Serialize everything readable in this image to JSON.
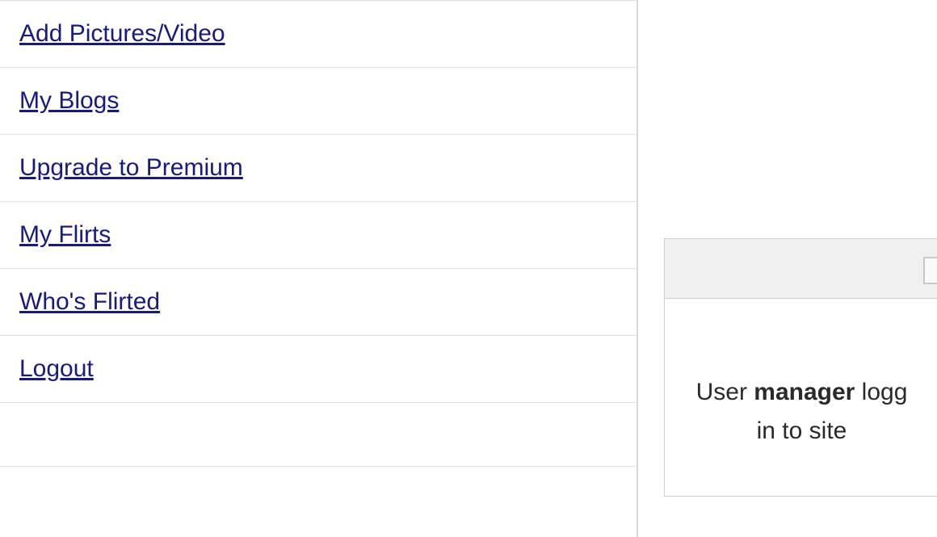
{
  "sidebar": {
    "items": [
      {
        "label": "Add Pictures/Video"
      },
      {
        "label": "My Blogs"
      },
      {
        "label": "Upgrade to Premium"
      },
      {
        "label": "My Flirts"
      },
      {
        "label": "Who's Flirted"
      },
      {
        "label": "Logout"
      }
    ]
  },
  "notification": {
    "prefix": "User ",
    "username": "manager",
    "suffix_line1": " logg",
    "line2": "in to site"
  }
}
